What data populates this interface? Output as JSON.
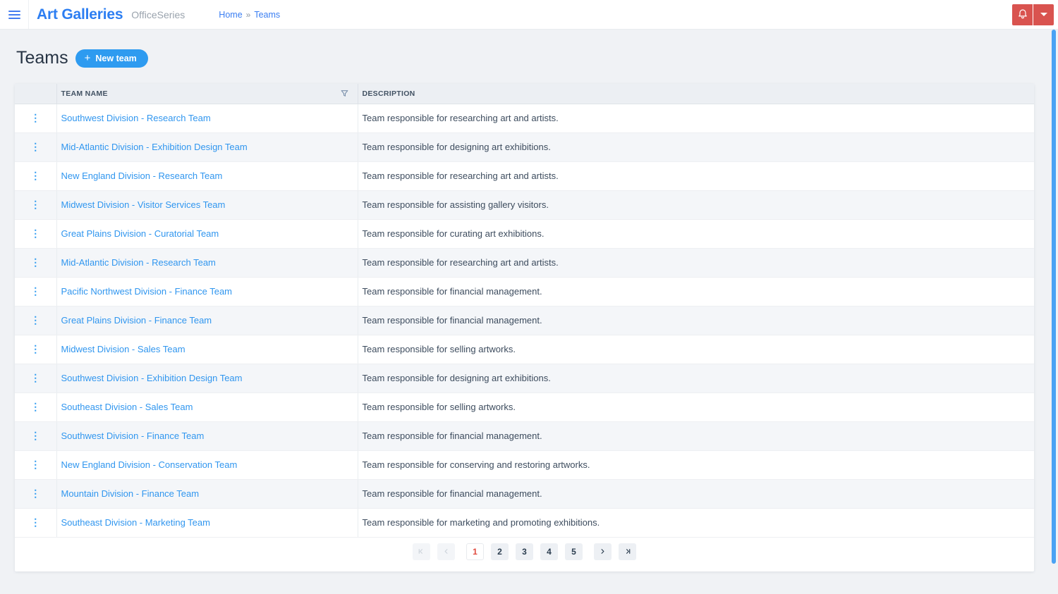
{
  "header": {
    "app_name": "Art Galleries",
    "app_suffix": "OfficeSeries",
    "breadcrumb": {
      "home": "Home",
      "separator": "»",
      "current": "Teams"
    }
  },
  "page": {
    "title": "Teams",
    "new_team_plus": "+",
    "new_team_label": "New team"
  },
  "table": {
    "headers": {
      "team_name": "TEAM NAME",
      "description": "DESCRIPTION"
    },
    "rows": [
      {
        "name": "Southwest Division - Research Team",
        "description": "Team responsible for researching art and artists."
      },
      {
        "name": "Mid-Atlantic Division - Exhibition Design Team",
        "description": "Team responsible for designing art exhibitions."
      },
      {
        "name": "New England Division - Research Team",
        "description": "Team responsible for researching art and artists."
      },
      {
        "name": "Midwest Division - Visitor Services Team",
        "description": "Team responsible for assisting gallery visitors."
      },
      {
        "name": "Great Plains Division - Curatorial Team",
        "description": "Team responsible for curating art exhibitions."
      },
      {
        "name": "Mid-Atlantic Division - Research Team",
        "description": "Team responsible for researching art and artists."
      },
      {
        "name": "Pacific Northwest Division - Finance Team",
        "description": "Team responsible for financial management."
      },
      {
        "name": "Great Plains Division - Finance Team",
        "description": "Team responsible for financial management."
      },
      {
        "name": "Midwest Division - Sales Team",
        "description": "Team responsible for selling artworks."
      },
      {
        "name": "Southwest Division - Exhibition Design Team",
        "description": "Team responsible for designing art exhibitions."
      },
      {
        "name": "Southeast Division - Sales Team",
        "description": "Team responsible for selling artworks."
      },
      {
        "name": "Southwest Division - Finance Team",
        "description": "Team responsible for financial management."
      },
      {
        "name": "New England Division - Conservation Team",
        "description": "Team responsible for conserving and restoring artworks."
      },
      {
        "name": "Mountain Division - Finance Team",
        "description": "Team responsible for financial management."
      },
      {
        "name": "Southeast Division - Marketing Team",
        "description": "Team responsible for marketing and promoting exhibitions."
      }
    ]
  },
  "pagination": {
    "pages": [
      "1",
      "2",
      "3",
      "4",
      "5"
    ],
    "current_page": "1"
  },
  "icons": {
    "menu_icon": "hamburger",
    "bell_icon": "notification-bell",
    "caret_down_icon": "caret-down",
    "filter_icon": "funnel",
    "kebab_icon": "⋮",
    "first_page_icon": "chevron-left-bar",
    "prev_page_icon": "chevron-left",
    "next_page_icon": "chevron-right",
    "last_page_icon": "chevron-right-bar"
  },
  "colors": {
    "accent_blue": "#2e9bf0",
    "logo_blue": "#2c7ef2",
    "danger_red": "#d9534f",
    "current_page_red": "#e0493d",
    "dark_text": "#273444",
    "link_blue": "#3096ef",
    "scrollbar_blue": "#4aa2f4",
    "page_background": "#f0f2f5",
    "table_header_bg": "#eceff3",
    "row_alt_bg": "#f4f6f9"
  }
}
